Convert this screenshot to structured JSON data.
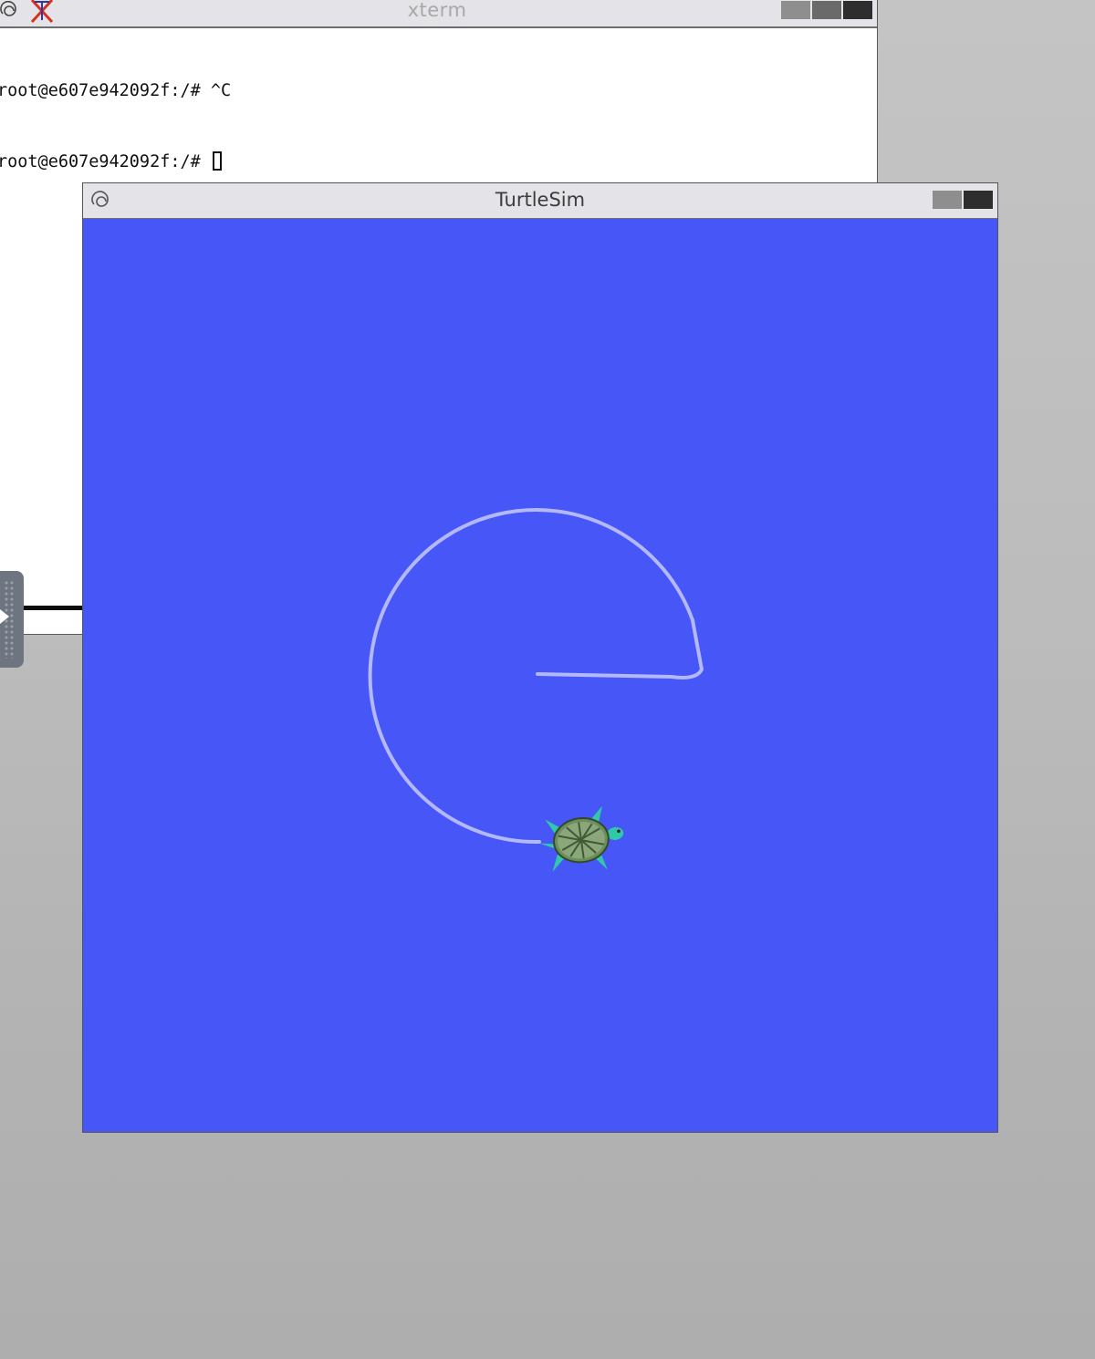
{
  "xterm": {
    "title": "xterm",
    "lines": [
      "root@e607e942092f:/# ^C",
      "root@e607e942092f:/# "
    ],
    "title_icons": [
      "debian-swirl-icon",
      "x-logo-icon"
    ],
    "buttons": [
      "minimize",
      "maximize",
      "close"
    ]
  },
  "turtlesim": {
    "title": "TurtleSim",
    "title_icons": [
      "debian-swirl-icon"
    ],
    "buttons": [
      "maximize",
      "close"
    ],
    "canvas": {
      "background_color": "#4756f6",
      "pen_color": "#b3b8ff",
      "pen_path": "open-circle-with-radius-line",
      "turtle_icon": "turtle-icon"
    }
  },
  "colors": {
    "desktop": "#bdbdbd",
    "titlebar": "#e4e4e8",
    "xterm_title_text": "#a8a8a8",
    "turtlesim_title_text": "#3c3c3c"
  }
}
